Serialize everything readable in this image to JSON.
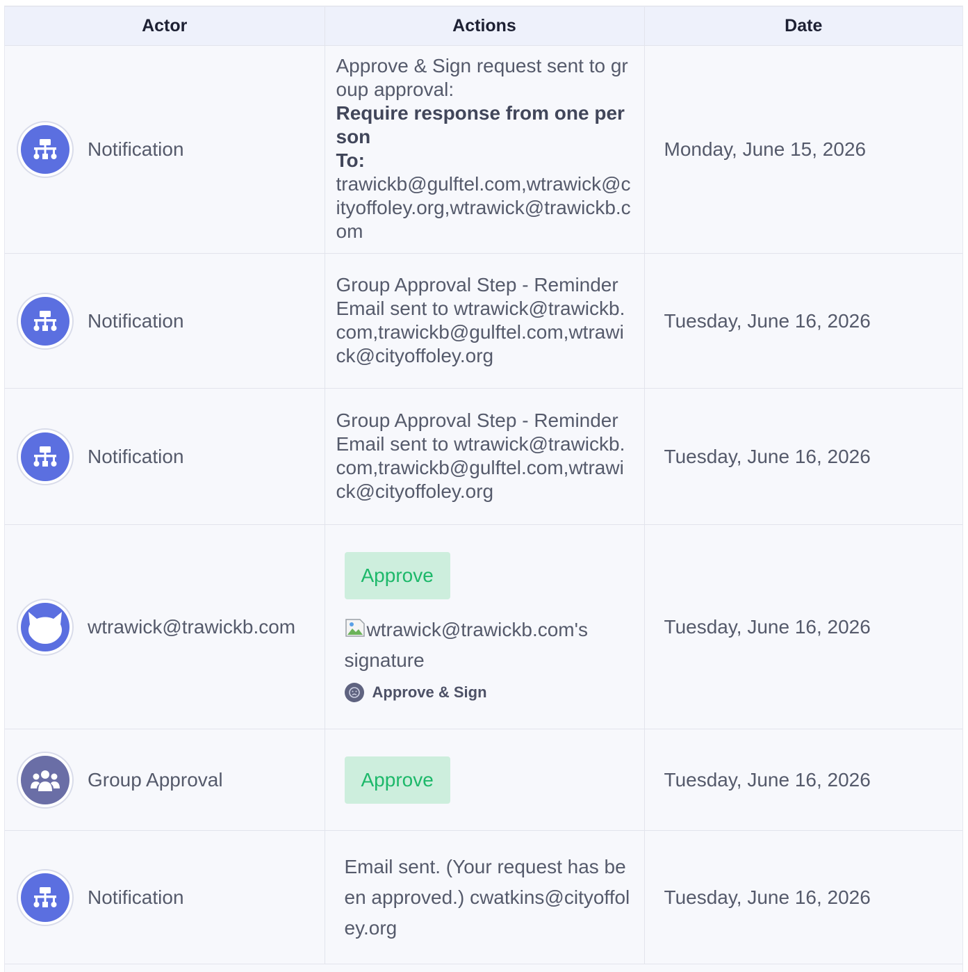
{
  "columns": {
    "actor": "Actor",
    "actions": "Actions",
    "date": "Date"
  },
  "rows": [
    {
      "actor": "Notification",
      "icon": "hierarchy-icon",
      "action_line1": "Approve & Sign request sent to group approval:",
      "action_bold": "Require response from one person",
      "action_to_label": "To:",
      "action_recipients": "trawickb@gulftel.com,wtrawick@cityoffoley.org,wtrawick@trawickb.com",
      "date": "Monday, June 15, 2026"
    },
    {
      "actor": "Notification",
      "icon": "hierarchy-icon",
      "action_text": "Group Approval Step - Reminder Email sent to wtrawick@trawickb.com,trawickb@gulftel.com,wtrawick@cityoffoley.org",
      "date": "Tuesday, June 16, 2026"
    },
    {
      "actor": "Notification",
      "icon": "hierarchy-icon",
      "action_text": "Group Approval Step - Reminder Email sent to wtrawick@trawickb.com,trawickb@gulftel.com,wtrawick@cityoffoley.org",
      "date": "Tuesday, June 16, 2026"
    },
    {
      "actor": "wtrawick@trawickb.com",
      "icon": "cat-avatar-icon",
      "approve_label": "Approve",
      "signature_alt": "wtrawick@trawickb.com's signature",
      "approve_sign_label": "Approve & Sign",
      "date": "Tuesday, June 16, 2026"
    },
    {
      "actor": "Group Approval",
      "icon": "group-icon",
      "approve_label": "Approve",
      "date": "Tuesday, June 16, 2026"
    },
    {
      "actor": "Notification",
      "icon": "hierarchy-icon",
      "action_text": "Email sent. (Your request has been approved.) cwatkins@cityoffoley.org",
      "date": "Tuesday, June 16, 2026"
    }
  ],
  "colors": {
    "header_bg": "#eef1fb",
    "row_bg": "#f7f8fc",
    "avatar_blue": "#5b6fe0",
    "avatar_slate": "#6a6ea6",
    "approve_bg": "#cdeedd",
    "approve_text": "#1db86a"
  }
}
